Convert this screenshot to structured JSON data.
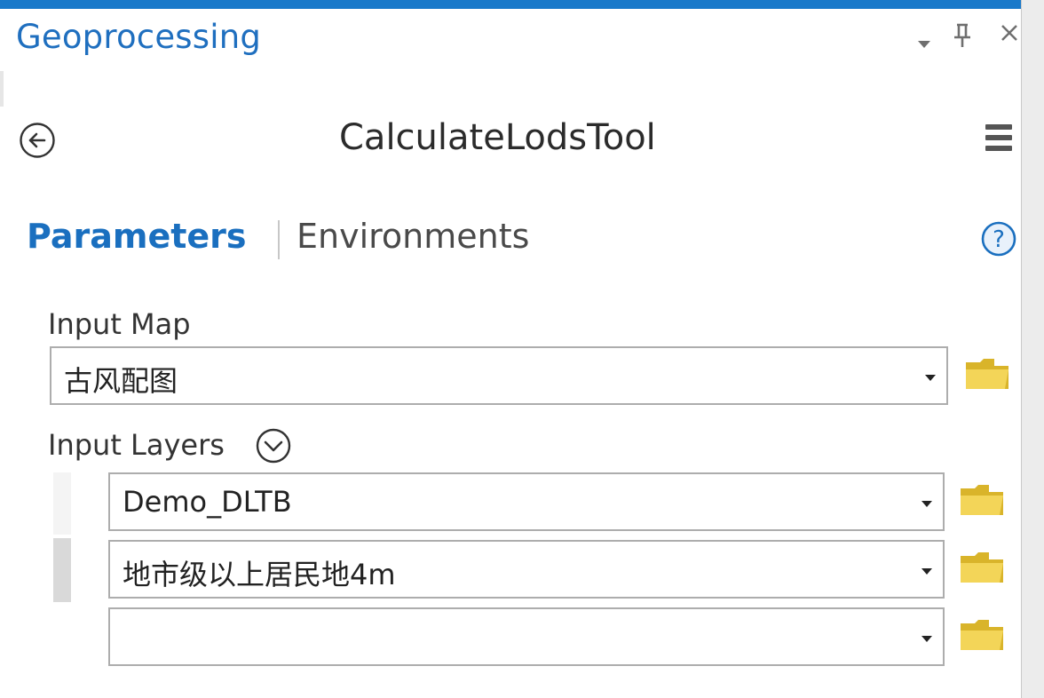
{
  "pane": {
    "title": "Geoprocessing",
    "menu_icon": "dropdown-arrow-icon",
    "pin_glyph": "㌧",
    "close_glyph": "×"
  },
  "tool": {
    "name": "CalculateLodsTool",
    "back_icon": "back-arrow-circle-icon",
    "options_icon": "hamburger-menu-icon"
  },
  "tabs": {
    "parameters": "Parameters",
    "environments": "Environments",
    "help_icon": "help-question-icon"
  },
  "params": {
    "input_map": {
      "label": "Input Map",
      "value": "古风配图"
    },
    "input_layers": {
      "label": "Input Layers",
      "items": [
        {
          "value": "Demo_DLTB"
        },
        {
          "value": "地市级以上居民地4m"
        },
        {
          "value": ""
        }
      ]
    }
  },
  "colors": {
    "accent": "#1979ca",
    "title_blue": "#1f6fbf",
    "folder_yellow": "#e9c93a"
  }
}
